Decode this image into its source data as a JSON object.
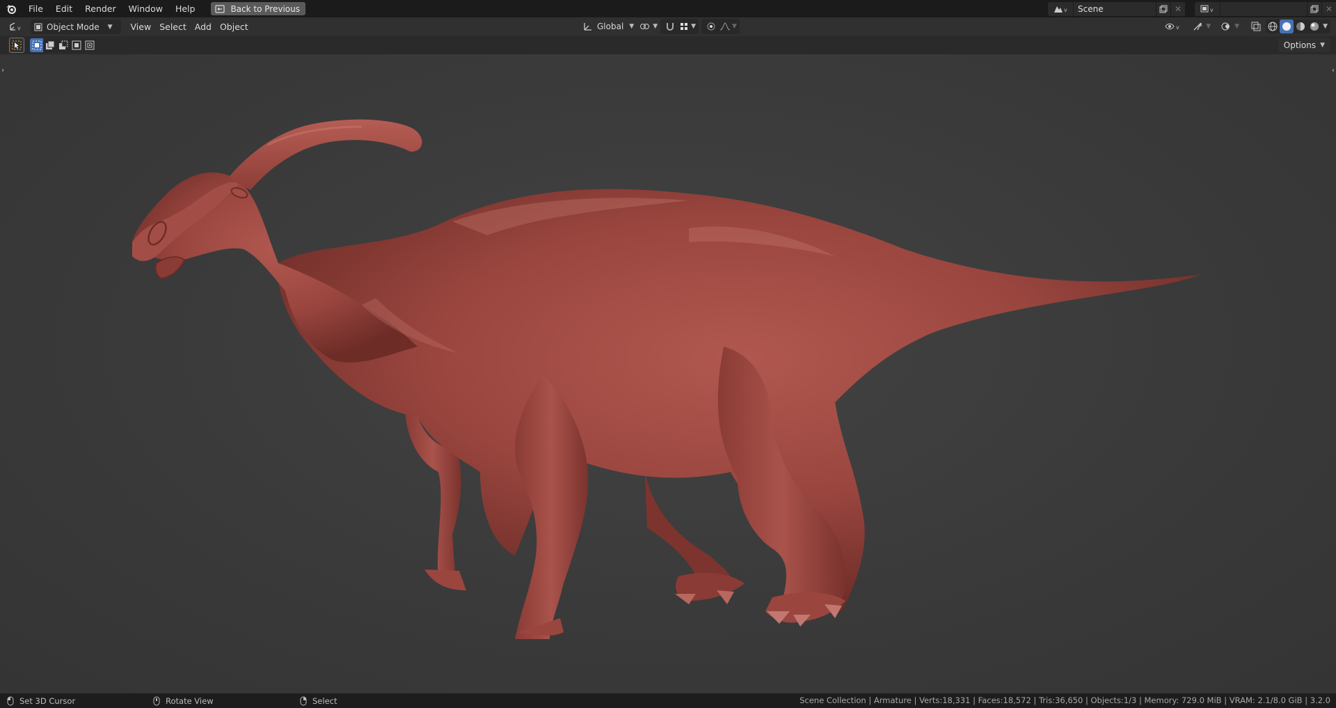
{
  "menubar": {
    "items": [
      "File",
      "Edit",
      "Render",
      "Window",
      "Help"
    ],
    "back_button": "Back to Previous",
    "scene_name": "Scene",
    "view_layer_name": ""
  },
  "header": {
    "mode": "Object Mode",
    "menus": [
      "View",
      "Select",
      "Add",
      "Object"
    ],
    "transform_orientation": "Global"
  },
  "toolrow": {
    "options_label": "Options"
  },
  "statusbar": {
    "hints": [
      {
        "icon": "mouse-left-icon",
        "label": "Set 3D Cursor"
      },
      {
        "icon": "mouse-middle-icon",
        "label": "Rotate View"
      },
      {
        "icon": "mouse-right-icon",
        "label": "Select"
      }
    ],
    "info": "Scene Collection | Armature | Verts:18,331 | Faces:18,572 | Tris:36,650 | Objects:1/3 | Memory: 729.0 MiB | VRAM: 2.1/8.0 GiB | 3.2.0"
  },
  "colors": {
    "accent": "#4772b3",
    "model": "#9b4a42",
    "viewport_bg": "#3d3d3d"
  }
}
